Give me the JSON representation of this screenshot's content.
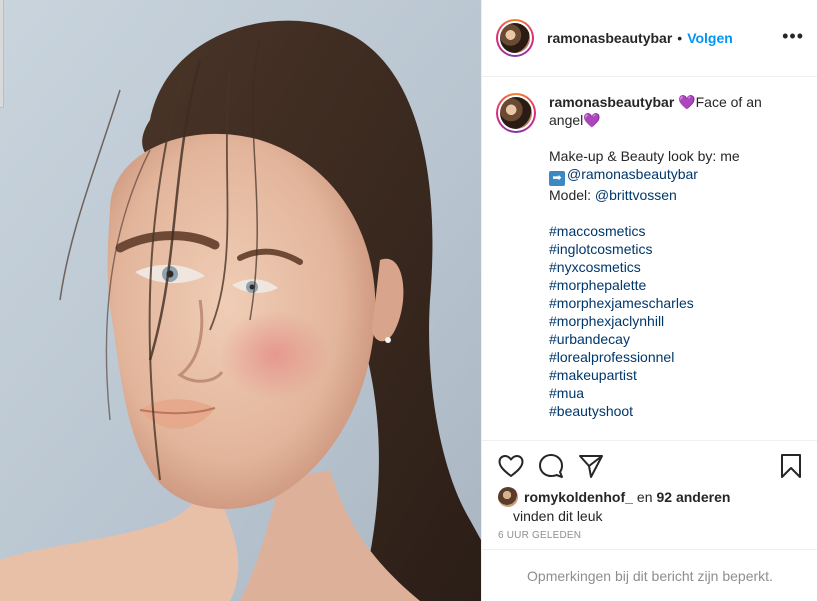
{
  "post": {
    "username": "ramonasbeautybar",
    "separator": "•",
    "follow_label": "Volgen",
    "more_label": "•••"
  },
  "caption": {
    "username": "ramonasbeautybar",
    "heart_1": "💜",
    "line_1": "Face of an",
    "line_2": "angel",
    "heart_2": "💜",
    "credit_label": "Make-up & Beauty look by: me",
    "arrow_emoji": "➡",
    "credit_handle": "@ramonasbeautybar",
    "model_label": "Model:",
    "model_handle": "@brittvossen",
    "hashtags": [
      "#maccosmetics",
      "#inglotcosmetics",
      "#nyxcosmetics",
      "#morphepalette",
      "#morphexjamescharles",
      "#morphexjaclynhill",
      "#urbandecay",
      "#lorealprofessionnel",
      "#makeupartist",
      "#mua",
      "#beautyshoot"
    ]
  },
  "actions": {
    "icons": [
      "heart-icon",
      "comment-icon",
      "share-icon",
      "bookmark-icon"
    ]
  },
  "likes": {
    "liker": "romykoldenhof_",
    "connector": "en",
    "others": "92 anderen",
    "suffix": "vinden dit leuk"
  },
  "timestamp": "6 UUR GELEDEN",
  "comments_notice": "Opmerkingen bij dit bericht zijn beperkt.",
  "colors": {
    "link": "#0095f6",
    "hashtag": "#00376b",
    "muted": "#8e8e8e",
    "text": "#262626",
    "border": "#efefef"
  }
}
